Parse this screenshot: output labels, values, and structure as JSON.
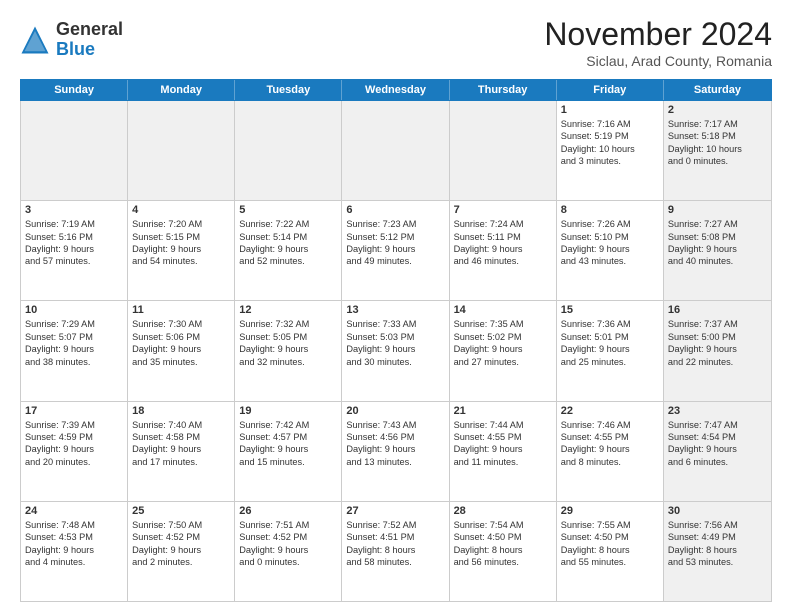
{
  "header": {
    "logo": {
      "line1": "General",
      "line2": "Blue"
    },
    "title": "November 2024",
    "location": "Siclau, Arad County, Romania"
  },
  "weekdays": [
    "Sunday",
    "Monday",
    "Tuesday",
    "Wednesday",
    "Thursday",
    "Friday",
    "Saturday"
  ],
  "rows": [
    [
      {
        "day": "",
        "text": "",
        "shaded": true
      },
      {
        "day": "",
        "text": "",
        "shaded": true
      },
      {
        "day": "",
        "text": "",
        "shaded": true
      },
      {
        "day": "",
        "text": "",
        "shaded": true
      },
      {
        "day": "",
        "text": "",
        "shaded": true
      },
      {
        "day": "1",
        "text": "Sunrise: 7:16 AM\nSunset: 5:19 PM\nDaylight: 10 hours\nand 3 minutes.",
        "shaded": false
      },
      {
        "day": "2",
        "text": "Sunrise: 7:17 AM\nSunset: 5:18 PM\nDaylight: 10 hours\nand 0 minutes.",
        "shaded": true
      }
    ],
    [
      {
        "day": "3",
        "text": "Sunrise: 7:19 AM\nSunset: 5:16 PM\nDaylight: 9 hours\nand 57 minutes.",
        "shaded": false
      },
      {
        "day": "4",
        "text": "Sunrise: 7:20 AM\nSunset: 5:15 PM\nDaylight: 9 hours\nand 54 minutes.",
        "shaded": false
      },
      {
        "day": "5",
        "text": "Sunrise: 7:22 AM\nSunset: 5:14 PM\nDaylight: 9 hours\nand 52 minutes.",
        "shaded": false
      },
      {
        "day": "6",
        "text": "Sunrise: 7:23 AM\nSunset: 5:12 PM\nDaylight: 9 hours\nand 49 minutes.",
        "shaded": false
      },
      {
        "day": "7",
        "text": "Sunrise: 7:24 AM\nSunset: 5:11 PM\nDaylight: 9 hours\nand 46 minutes.",
        "shaded": false
      },
      {
        "day": "8",
        "text": "Sunrise: 7:26 AM\nSunset: 5:10 PM\nDaylight: 9 hours\nand 43 minutes.",
        "shaded": false
      },
      {
        "day": "9",
        "text": "Sunrise: 7:27 AM\nSunset: 5:08 PM\nDaylight: 9 hours\nand 40 minutes.",
        "shaded": true
      }
    ],
    [
      {
        "day": "10",
        "text": "Sunrise: 7:29 AM\nSunset: 5:07 PM\nDaylight: 9 hours\nand 38 minutes.",
        "shaded": false
      },
      {
        "day": "11",
        "text": "Sunrise: 7:30 AM\nSunset: 5:06 PM\nDaylight: 9 hours\nand 35 minutes.",
        "shaded": false
      },
      {
        "day": "12",
        "text": "Sunrise: 7:32 AM\nSunset: 5:05 PM\nDaylight: 9 hours\nand 32 minutes.",
        "shaded": false
      },
      {
        "day": "13",
        "text": "Sunrise: 7:33 AM\nSunset: 5:03 PM\nDaylight: 9 hours\nand 30 minutes.",
        "shaded": false
      },
      {
        "day": "14",
        "text": "Sunrise: 7:35 AM\nSunset: 5:02 PM\nDaylight: 9 hours\nand 27 minutes.",
        "shaded": false
      },
      {
        "day": "15",
        "text": "Sunrise: 7:36 AM\nSunset: 5:01 PM\nDaylight: 9 hours\nand 25 minutes.",
        "shaded": false
      },
      {
        "day": "16",
        "text": "Sunrise: 7:37 AM\nSunset: 5:00 PM\nDaylight: 9 hours\nand 22 minutes.",
        "shaded": true
      }
    ],
    [
      {
        "day": "17",
        "text": "Sunrise: 7:39 AM\nSunset: 4:59 PM\nDaylight: 9 hours\nand 20 minutes.",
        "shaded": false
      },
      {
        "day": "18",
        "text": "Sunrise: 7:40 AM\nSunset: 4:58 PM\nDaylight: 9 hours\nand 17 minutes.",
        "shaded": false
      },
      {
        "day": "19",
        "text": "Sunrise: 7:42 AM\nSunset: 4:57 PM\nDaylight: 9 hours\nand 15 minutes.",
        "shaded": false
      },
      {
        "day": "20",
        "text": "Sunrise: 7:43 AM\nSunset: 4:56 PM\nDaylight: 9 hours\nand 13 minutes.",
        "shaded": false
      },
      {
        "day": "21",
        "text": "Sunrise: 7:44 AM\nSunset: 4:55 PM\nDaylight: 9 hours\nand 11 minutes.",
        "shaded": false
      },
      {
        "day": "22",
        "text": "Sunrise: 7:46 AM\nSunset: 4:55 PM\nDaylight: 9 hours\nand 8 minutes.",
        "shaded": false
      },
      {
        "day": "23",
        "text": "Sunrise: 7:47 AM\nSunset: 4:54 PM\nDaylight: 9 hours\nand 6 minutes.",
        "shaded": true
      }
    ],
    [
      {
        "day": "24",
        "text": "Sunrise: 7:48 AM\nSunset: 4:53 PM\nDaylight: 9 hours\nand 4 minutes.",
        "shaded": false
      },
      {
        "day": "25",
        "text": "Sunrise: 7:50 AM\nSunset: 4:52 PM\nDaylight: 9 hours\nand 2 minutes.",
        "shaded": false
      },
      {
        "day": "26",
        "text": "Sunrise: 7:51 AM\nSunset: 4:52 PM\nDaylight: 9 hours\nand 0 minutes.",
        "shaded": false
      },
      {
        "day": "27",
        "text": "Sunrise: 7:52 AM\nSunset: 4:51 PM\nDaylight: 8 hours\nand 58 minutes.",
        "shaded": false
      },
      {
        "day": "28",
        "text": "Sunrise: 7:54 AM\nSunset: 4:50 PM\nDaylight: 8 hours\nand 56 minutes.",
        "shaded": false
      },
      {
        "day": "29",
        "text": "Sunrise: 7:55 AM\nSunset: 4:50 PM\nDaylight: 8 hours\nand 55 minutes.",
        "shaded": false
      },
      {
        "day": "30",
        "text": "Sunrise: 7:56 AM\nSunset: 4:49 PM\nDaylight: 8 hours\nand 53 minutes.",
        "shaded": true
      }
    ]
  ]
}
